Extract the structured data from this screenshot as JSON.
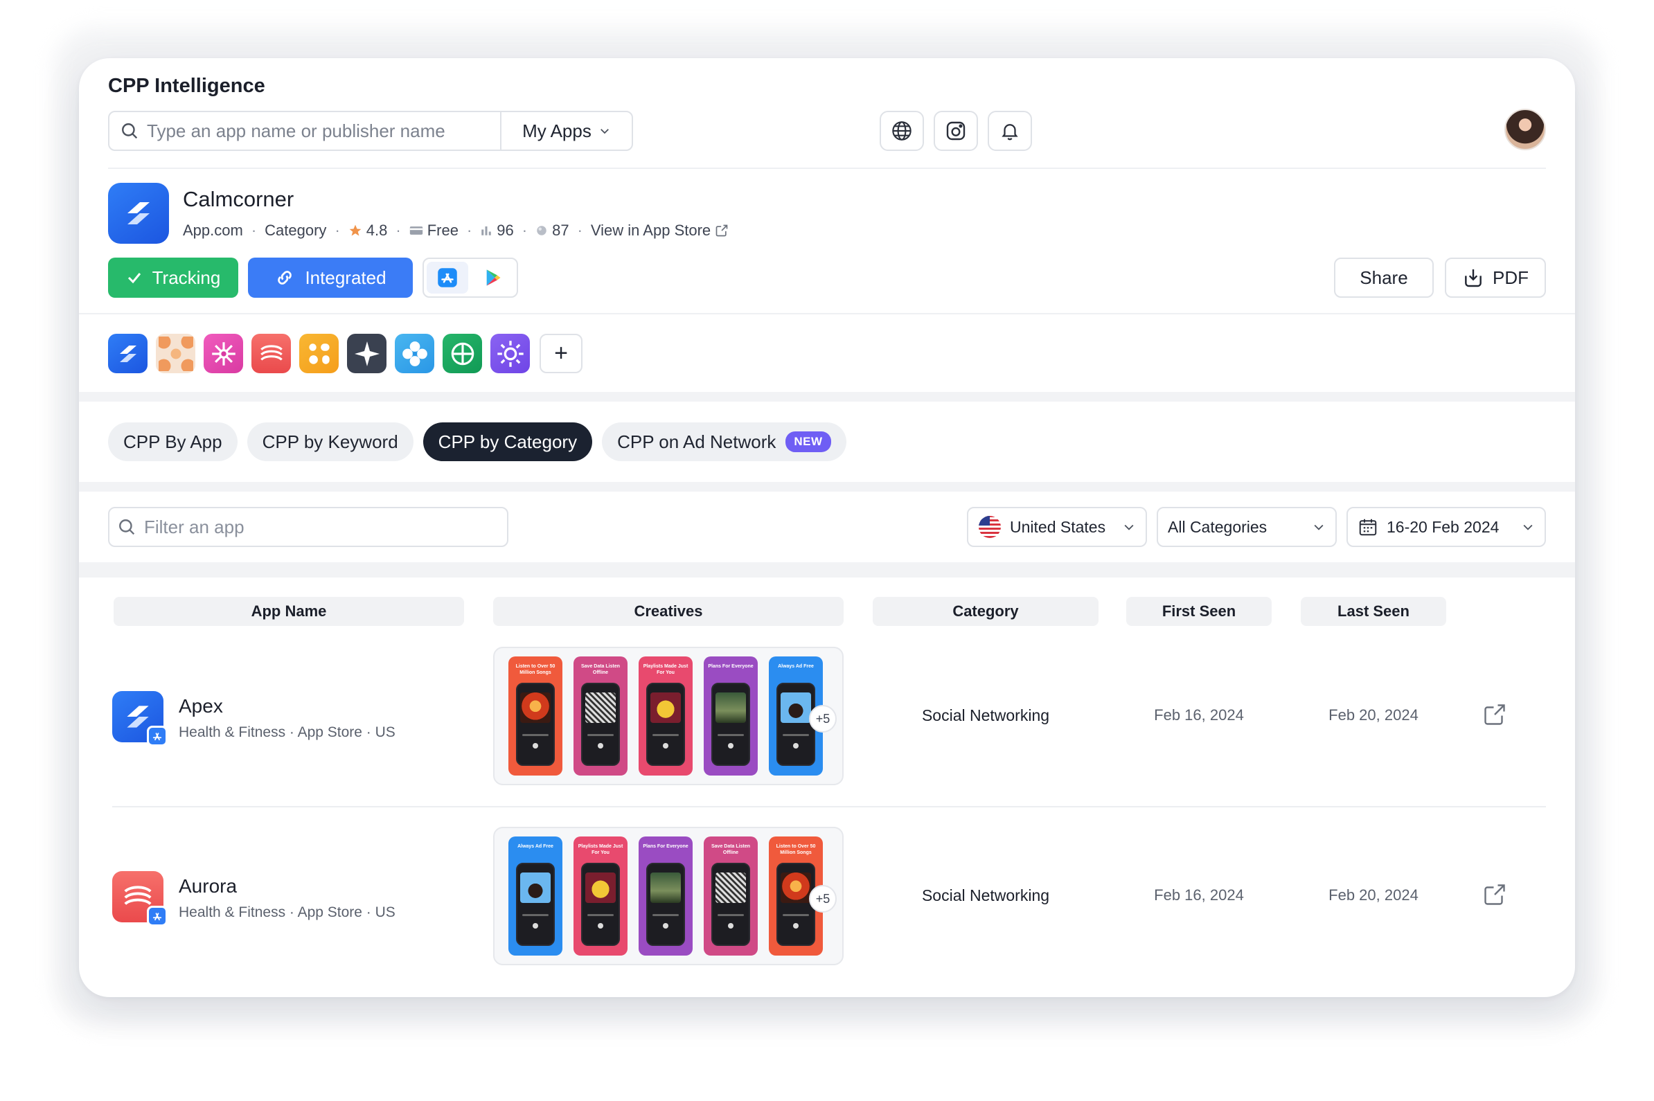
{
  "page": {
    "title": "CPP Intelligence"
  },
  "search": {
    "placeholder": "Type an app name or publisher name",
    "scope_label": "My Apps"
  },
  "header_icons": [
    "globe-icon",
    "instagram-icon",
    "bell-icon",
    "avatar"
  ],
  "app": {
    "name": "Calmcorner",
    "publisher": "App.com",
    "category": "Category",
    "rating": "4.8",
    "price": "Free",
    "rank": "96",
    "score": "87",
    "store_link": "View in App Store"
  },
  "actions": {
    "tracking": "Tracking",
    "integrated": "Integrated",
    "share": "Share",
    "pdf": "PDF"
  },
  "tray_icons": [
    "calmcorner-icon",
    "orange-pattern-icon",
    "pink-flower-icon",
    "red-waves-icon",
    "yellow-pattern-icon",
    "star-icon",
    "blue-petals-icon",
    "green-leaf-icon",
    "purple-sun-icon"
  ],
  "tray_add": "+",
  "tabs": [
    {
      "label": "CPP By App",
      "active": false
    },
    {
      "label": "CPP by Keyword",
      "active": false
    },
    {
      "label": "CPP by Category",
      "active": true
    },
    {
      "label": "CPP on Ad Network",
      "active": false,
      "badge": "NEW"
    }
  ],
  "filters": {
    "filter_placeholder": "Filter an app",
    "country": "United States",
    "category": "All Categories",
    "date_range": "16-20 Feb 2024"
  },
  "table": {
    "columns": [
      "App Name",
      "Creatives",
      "Category",
      "First Seen",
      "Last Seen"
    ],
    "rows": [
      {
        "name": "Apex",
        "meta": "Health & Fitness · App Store · US",
        "creatives": [
          {
            "caption": "Listen to Over 50 Million Songs",
            "color": "#f05a3c"
          },
          {
            "caption": "Save Data Listen Offline",
            "color": "#d04a86"
          },
          {
            "caption": "Playlists Made Just For You",
            "color": "#e84a6e"
          },
          {
            "caption": "Plans For Everyone",
            "color": "#9a4cc2"
          },
          {
            "caption": "Always Ad Free",
            "color": "#2b8df0"
          }
        ],
        "more": "+5",
        "category": "Social Networking",
        "first_seen": "Feb 16, 2024",
        "last_seen": "Feb 20, 2024"
      },
      {
        "name": "Aurora",
        "meta": "Health & Fitness · App Store · US",
        "creatives": [
          {
            "caption": "Always Ad Free",
            "color": "#2b8df0"
          },
          {
            "caption": "Playlists Made Just For You",
            "color": "#e84a6e"
          },
          {
            "caption": "Plans For Everyone",
            "color": "#9a4cc2"
          },
          {
            "caption": "Save Data Listen Offline",
            "color": "#d04a86"
          },
          {
            "caption": "Listen to Over 50 Million Songs",
            "color": "#f05a3c"
          }
        ],
        "more": "+5",
        "category": "Social Networking",
        "first_seen": "Feb 16, 2024",
        "last_seen": "Feb 20, 2024"
      }
    ]
  },
  "colors": {
    "tracking": "#27ba6b",
    "integrated": "#3b7cf6",
    "active_tab": "#1b2230",
    "new_badge": "#6f5ef4"
  }
}
